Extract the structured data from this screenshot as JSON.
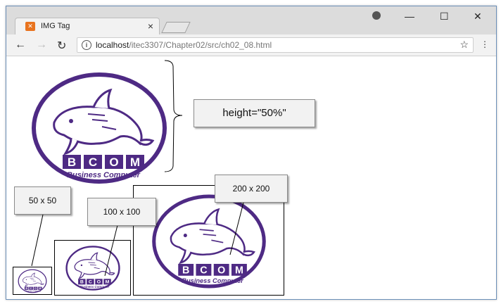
{
  "tab": {
    "title": "IMG Tag",
    "close": "×"
  },
  "window_controls": {
    "minimize": "—",
    "maximize": "☐",
    "close": "✕"
  },
  "nav": {
    "back": "←",
    "forward": "→",
    "reload": "↻",
    "info": "i",
    "star": "☆",
    "menu": "⋮"
  },
  "address": {
    "host": "localhost",
    "path": "/itec3307/Chapter02/src/ch02_08.html"
  },
  "logo": {
    "brand": "BCOM",
    "tagline": "Business Computer"
  },
  "callouts": {
    "height": "height=\"50%\"",
    "size50": "50 x 50",
    "size100": "100 x 100",
    "size200": "200 x 200"
  },
  "colors": {
    "accent": "#4e2a84",
    "favicon": "#e8731e"
  }
}
